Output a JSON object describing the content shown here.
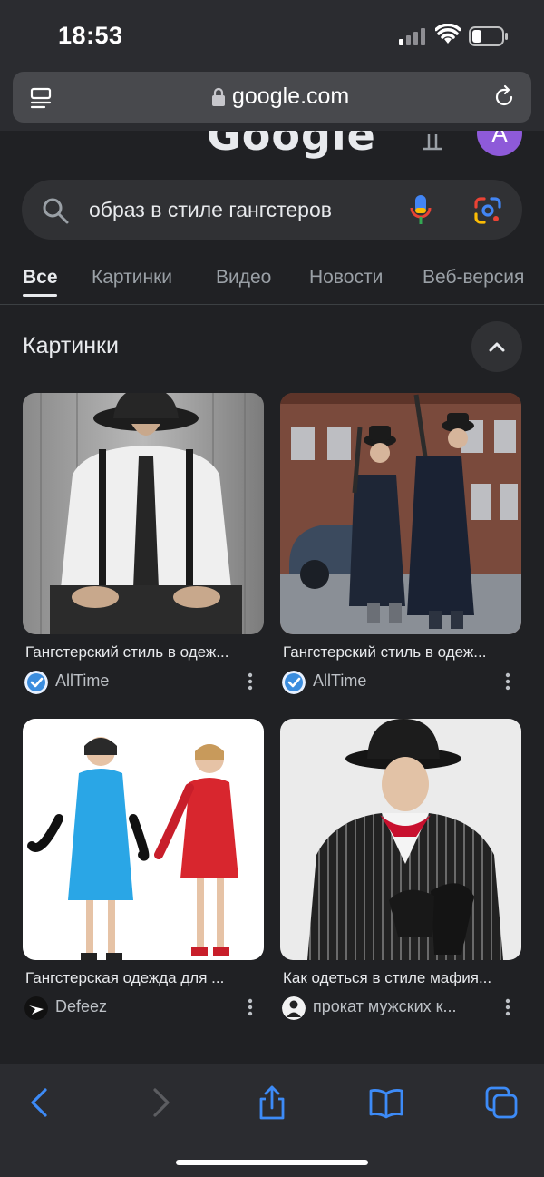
{
  "status": {
    "time": "18:53"
  },
  "address_bar": {
    "url": "google.com"
  },
  "google": {
    "logo": "Google",
    "avatar_letter": "A"
  },
  "search": {
    "query": "образ в стиле гангстеров"
  },
  "tabs": [
    {
      "label": "Все",
      "active": true
    },
    {
      "label": "Картинки"
    },
    {
      "label": "Видео"
    },
    {
      "label": "Новости"
    },
    {
      "label": "Веб-версия"
    }
  ],
  "images_section": {
    "title": "Картинки",
    "results": [
      {
        "caption": "Гангстерский стиль в одеж...",
        "source": "AllTime",
        "source_icon": "alltime-icon"
      },
      {
        "caption": "Гангстерский стиль в одеж...",
        "source": "AllTime",
        "source_icon": "alltime-icon"
      },
      {
        "caption": "Гангстерская одежда для ...",
        "source": "Defeez",
        "source_icon": "defeez-icon"
      },
      {
        "caption": "Как одеться в стиле мафия...",
        "source": "прокат мужских к...",
        "source_icon": "rental-icon"
      }
    ]
  },
  "colors": {
    "accent_ios": "#3d8bf7",
    "background": "#202124",
    "avatar": "#8e5ad9"
  }
}
